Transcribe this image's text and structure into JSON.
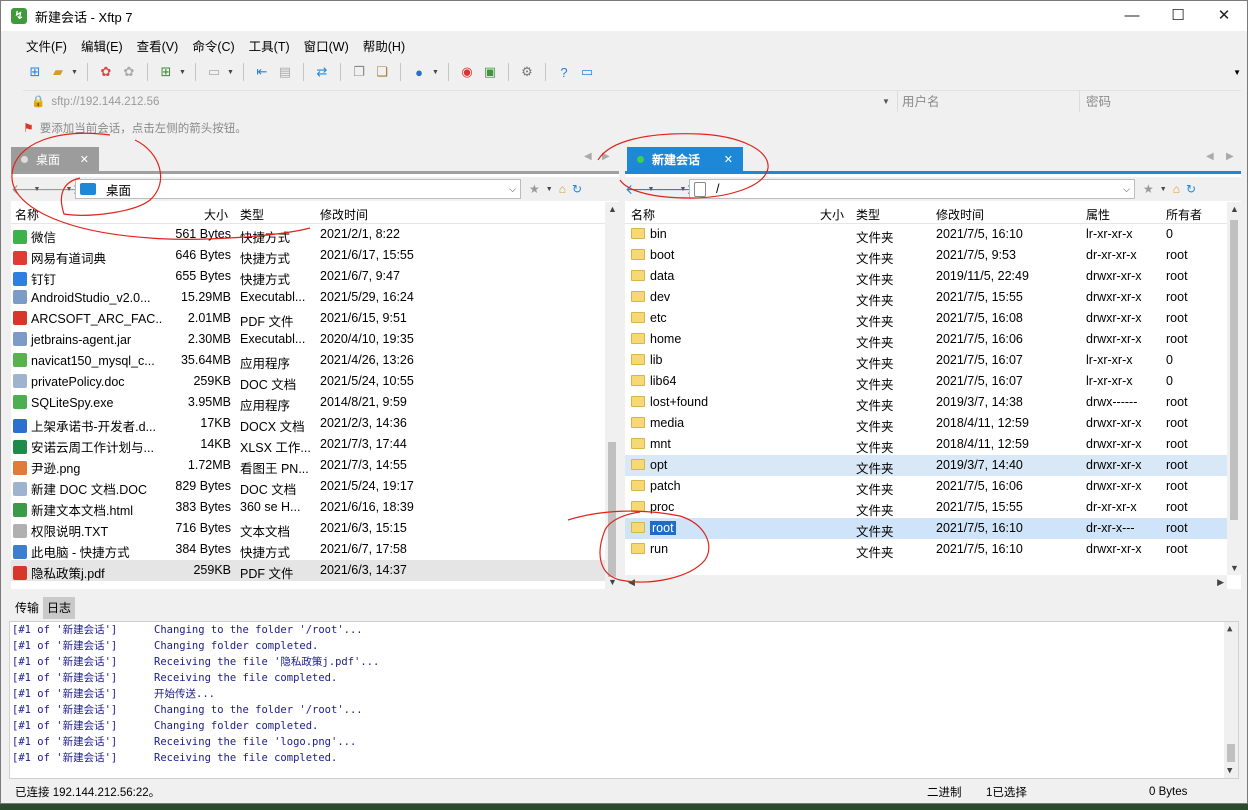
{
  "window": {
    "title": "新建会话 - Xftp 7",
    "app_icon": "xftp-icon"
  },
  "menu": [
    "文件(F)",
    "编辑(E)",
    "查看(V)",
    "命令(C)",
    "工具(T)",
    "窗口(W)",
    "帮助(H)"
  ],
  "address_bar": {
    "host": "sftp://192.144.212.56",
    "username_placeholder": "用户名",
    "password_placeholder": "密码"
  },
  "hint": "要添加当前会话，点击左侧的箭头按钮。",
  "left": {
    "tab": "桌面",
    "path": "桌面",
    "columns": [
      "名称",
      "大小",
      "类型",
      "修改时间"
    ],
    "rows": [
      {
        "name": "微信",
        "size": "561 Bytes",
        "type": "快捷方式",
        "mtime": "2021/2/1, 8:22",
        "icon": "#3cb34a"
      },
      {
        "name": "网易有道词典",
        "size": "646 Bytes",
        "type": "快捷方式",
        "mtime": "2021/6/17, 15:55",
        "icon": "#e03a32"
      },
      {
        "name": "钉钉",
        "size": "655 Bytes",
        "type": "快捷方式",
        "mtime": "2021/6/7, 9:47",
        "icon": "#2e7fe0"
      },
      {
        "name": "AndroidStudio_v2.0...",
        "size": "15.29MB",
        "type": "Executabl...",
        "mtime": "2021/5/29, 16:24",
        "icon": "#7a9cc6"
      },
      {
        "name": "ARCSOFT_ARC_FAC...",
        "size": "2.01MB",
        "type": "PDF 文件",
        "mtime": "2021/6/15, 9:51",
        "icon": "#d9362b"
      },
      {
        "name": "jetbrains-agent.jar",
        "size": "2.30MB",
        "type": "Executabl...",
        "mtime": "2020/4/10, 19:35",
        "icon": "#7a9cc6"
      },
      {
        "name": "navicat150_mysql_c...",
        "size": "35.64MB",
        "type": "应用程序",
        "mtime": "2021/4/26, 13:26",
        "icon": "#59b24d"
      },
      {
        "name": "privatePolicy.doc",
        "size": "259KB",
        "type": "DOC 文档",
        "mtime": "2021/5/24, 10:55",
        "icon": "#9fb3cf"
      },
      {
        "name": "SQLiteSpy.exe",
        "size": "3.95MB",
        "type": "应用程序",
        "mtime": "2014/8/21, 9:59",
        "icon": "#4caf50"
      },
      {
        "name": "上架承诺书-开发者.d...",
        "size": "17KB",
        "type": "DOCX 文档",
        "mtime": "2021/2/3, 14:36",
        "icon": "#2b6fcf"
      },
      {
        "name": "安诺云周工作计划与...",
        "size": "14KB",
        "type": "XLSX 工作...",
        "mtime": "2021/7/3, 17:44",
        "icon": "#1f8a4c"
      },
      {
        "name": "尹逊.png",
        "size": "1.72MB",
        "type": "看图王 PN...",
        "mtime": "2021/7/3, 14:55",
        "icon": "#e07b39"
      },
      {
        "name": "新建 DOC 文档.DOC",
        "size": "829 Bytes",
        "type": "DOC 文档",
        "mtime": "2021/5/24, 19:17",
        "icon": "#9fb3cf"
      },
      {
        "name": "新建文本文档.html",
        "size": "383 Bytes",
        "type": "360 se H...",
        "mtime": "2021/6/16, 18:39",
        "icon": "#3a9a45"
      },
      {
        "name": "权限说明.TXT",
        "size": "716 Bytes",
        "type": "文本文档",
        "mtime": "2021/6/3, 15:15",
        "icon": "#b0b0b0"
      },
      {
        "name": "此电脑 - 快捷方式",
        "size": "384 Bytes",
        "type": "快捷方式",
        "mtime": "2021/6/7, 17:58",
        "icon": "#3c7fd0"
      },
      {
        "name": "隐私政策j.pdf",
        "size": "259KB",
        "type": "PDF 文件",
        "mtime": "2021/6/3, 14:37",
        "icon": "#d9362b"
      }
    ]
  },
  "right": {
    "tab": "新建会话",
    "path": "/",
    "columns": [
      "名称",
      "大小",
      "类型",
      "修改时间",
      "属性",
      "所有者"
    ],
    "rows": [
      {
        "name": "bin",
        "type": "文件夹",
        "mtime": "2021/7/5, 16:10",
        "attr": "lr-xr-xr-x",
        "owner": "0"
      },
      {
        "name": "boot",
        "type": "文件夹",
        "mtime": "2021/7/5, 9:53",
        "attr": "dr-xr-xr-x",
        "owner": "root"
      },
      {
        "name": "data",
        "type": "文件夹",
        "mtime": "2019/11/5, 22:49",
        "attr": "drwxr-xr-x",
        "owner": "root"
      },
      {
        "name": "dev",
        "type": "文件夹",
        "mtime": "2021/7/5, 15:55",
        "attr": "drwxr-xr-x",
        "owner": "root"
      },
      {
        "name": "etc",
        "type": "文件夹",
        "mtime": "2021/7/5, 16:08",
        "attr": "drwxr-xr-x",
        "owner": "root"
      },
      {
        "name": "home",
        "type": "文件夹",
        "mtime": "2021/7/5, 16:06",
        "attr": "drwxr-xr-x",
        "owner": "root"
      },
      {
        "name": "lib",
        "type": "文件夹",
        "mtime": "2021/7/5, 16:07",
        "attr": "lr-xr-xr-x",
        "owner": "0"
      },
      {
        "name": "lib64",
        "type": "文件夹",
        "mtime": "2021/7/5, 16:07",
        "attr": "lr-xr-xr-x",
        "owner": "0"
      },
      {
        "name": "lost+found",
        "type": "文件夹",
        "mtime": "2019/3/7, 14:38",
        "attr": "drwx------",
        "owner": "root"
      },
      {
        "name": "media",
        "type": "文件夹",
        "mtime": "2018/4/11, 12:59",
        "attr": "drwxr-xr-x",
        "owner": "root"
      },
      {
        "name": "mnt",
        "type": "文件夹",
        "mtime": "2018/4/11, 12:59",
        "attr": "drwxr-xr-x",
        "owner": "root"
      },
      {
        "name": "opt",
        "type": "文件夹",
        "mtime": "2019/3/7, 14:40",
        "attr": "drwxr-xr-x",
        "owner": "root"
      },
      {
        "name": "patch",
        "type": "文件夹",
        "mtime": "2021/7/5, 16:06",
        "attr": "drwxr-xr-x",
        "owner": "root"
      },
      {
        "name": "proc",
        "type": "文件夹",
        "mtime": "2021/7/5, 15:55",
        "attr": "dr-xr-xr-x",
        "owner": "root"
      },
      {
        "name": "root",
        "type": "文件夹",
        "mtime": "2021/7/5, 16:10",
        "attr": "dr-xr-x---",
        "owner": "root"
      },
      {
        "name": "run",
        "type": "文件夹",
        "mtime": "2021/7/5, 16:10",
        "attr": "drwxr-xr-x",
        "owner": "root"
      }
    ]
  },
  "log_tabs": [
    "传输",
    "日志"
  ],
  "log": [
    {
      "src": "[#1 of '新建会话']",
      "msg": "Changing to the folder '/root'..."
    },
    {
      "src": "[#1 of '新建会话']",
      "msg": "Changing folder completed."
    },
    {
      "src": "[#1 of '新建会话']",
      "msg": "Receiving the file '隐私政策j.pdf'..."
    },
    {
      "src": "[#1 of '新建会话']",
      "msg": "Receiving the file completed."
    },
    {
      "src": "[#1 of '新建会话']",
      "msg": "开始传送..."
    },
    {
      "src": "[#1 of '新建会话']",
      "msg": "Changing to the folder '/root'..."
    },
    {
      "src": "[#1 of '新建会话']",
      "msg": "Changing folder completed."
    },
    {
      "src": "[#1 of '新建会话']",
      "msg": "Receiving the file 'logo.png'..."
    },
    {
      "src": "[#1 of '新建会话']",
      "msg": "Receiving the file completed."
    }
  ],
  "status": {
    "connection": "已连接 192.144.212.56:22。",
    "mode": "二进制",
    "selection": "1已选择",
    "size": "0 Bytes"
  },
  "colors": {
    "accent": "#1e88d8",
    "annotation": "#e0241c"
  }
}
